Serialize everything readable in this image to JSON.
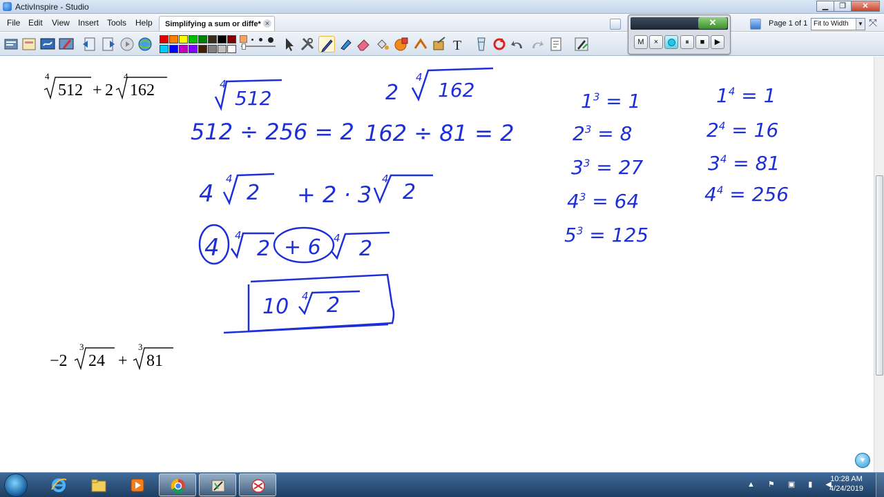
{
  "window": {
    "title": "ActivInspire - Studio"
  },
  "menu": [
    "File",
    "Edit",
    "View",
    "Insert",
    "Tools",
    "Help"
  ],
  "document_tab": {
    "label": "Simplifying a sum or diffe*"
  },
  "page_info": "Page 1 of 1",
  "zoom": {
    "selected": "Fit to Width"
  },
  "recorder": {
    "buttons": [
      "M",
      "×",
      "",
      "⏸",
      "■",
      "▶"
    ]
  },
  "palette": [
    "#e00000",
    "#ff7f00",
    "#ffff00",
    "#00c000",
    "#008000",
    "#3a2a1a",
    "#000000",
    "#800000",
    "#00c8ff",
    "#0000ff",
    "#c000c0",
    "#8000ff",
    "#402000",
    "#808080",
    "#c0c0c0",
    "#ffffff"
  ],
  "ink_color": "#1d2fd6",
  "problems": [
    {
      "id": "p1",
      "index": "4",
      "coef": "",
      "radicand": "512",
      "op": "+",
      "index2": "4",
      "coef2": "2",
      "radicand2": "162"
    },
    {
      "id": "p2",
      "index": "3",
      "coef": "−2",
      "radicand": "24",
      "op": "+",
      "index2": "3",
      "coef2": "",
      "radicand2": "81"
    }
  ],
  "handwriting": {
    "r1a_idx": "4",
    "r1a_rad": "512",
    "r1b_coef": "2",
    "r1b_idx": "4",
    "r1b_rad": "162",
    "div1": "512 ÷ 256 = 2",
    "div2": "162 ÷ 81 = 2",
    "step3_a": "4",
    "step3_a_idx": "4",
    "step3_a_rad": "2",
    "step3_b": "+ 2 · 3",
    "step3_b_idx": "4",
    "step3_b_rad": "2",
    "step4_a": "4",
    "step4_a_idx": "4",
    "step4_a_rad": "2",
    "step4_b": "+ 6",
    "step4_b_idx": "4",
    "step4_b_rad": "2",
    "answer_coef": "10",
    "answer_idx": "4",
    "answer_rad": "2",
    "cubes": [
      {
        "base": "1",
        "exp": "3",
        "value": "1"
      },
      {
        "base": "2",
        "exp": "3",
        "value": "8"
      },
      {
        "base": "3",
        "exp": "3",
        "value": "27"
      },
      {
        "base": "4",
        "exp": "3",
        "value": "64"
      },
      {
        "base": "5",
        "exp": "3",
        "value": "125"
      }
    ],
    "fourths": [
      {
        "base": "1",
        "exp": "4",
        "value": "1"
      },
      {
        "base": "2",
        "exp": "4",
        "value": "16"
      },
      {
        "base": "3",
        "exp": "4",
        "value": "81"
      },
      {
        "base": "4",
        "exp": "4",
        "value": "256"
      }
    ]
  },
  "taskbar": {
    "apps": [
      "Internet Explorer",
      "Windows Explorer",
      "Media Player",
      "Google Chrome",
      "ActivInspire",
      "Snipping Tool"
    ],
    "time": "10:28 AM",
    "date": "4/24/2019"
  }
}
